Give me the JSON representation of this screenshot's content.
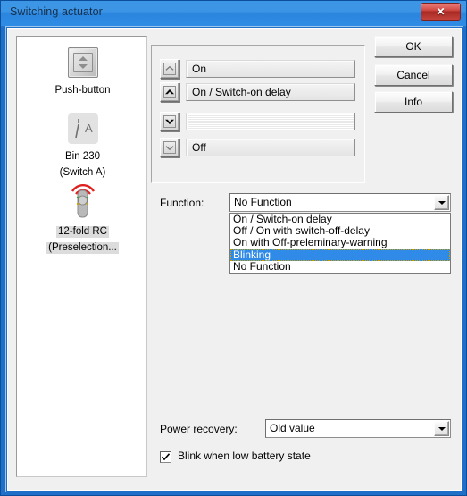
{
  "window": {
    "title": "Switching actuator",
    "close_label": "✕",
    "close_icon": "close-icon"
  },
  "devices": [
    {
      "id": "push-button",
      "icon": "push-button-icon",
      "lines": [
        "Push-button"
      ],
      "selected": false
    },
    {
      "id": "bin-230",
      "icon": "switch-contact-icon",
      "lines": [
        "Bin 230",
        "(Switch A)"
      ],
      "selected": false
    },
    {
      "id": "12-fold-rc",
      "icon": "remote-control-icon",
      "lines": [
        "12-fold RC",
        "(Preselection..."
      ],
      "selected": true
    }
  ],
  "buttons": [
    {
      "id": "ok",
      "label": "OK"
    },
    {
      "id": "cancel",
      "label": "Cancel"
    },
    {
      "id": "info",
      "label": "Info"
    }
  ],
  "scene_rows": [
    {
      "arrow": "chevron-up-light",
      "text": "On",
      "empty": false
    },
    {
      "arrow": "chevron-up-bold",
      "text": "On / Switch-on delay",
      "empty": false
    },
    {
      "arrow": "chevron-down-bold",
      "text": "",
      "empty": true
    },
    {
      "arrow": "chevron-down-light",
      "text": "Off",
      "empty": false
    }
  ],
  "function_field": {
    "label": "Function:",
    "value": "No Function",
    "options": [
      "On / Switch-on delay",
      "Off / On with switch-off-delay",
      "On with Off-preleminary-warning",
      "Blinking",
      "No Function"
    ],
    "selected_index": 3
  },
  "power_recovery": {
    "label": "Power recovery:",
    "value": "Old value"
  },
  "blink_checkbox": {
    "label": "Blink when low battery state",
    "checked": true,
    "check_glyph": "✔"
  },
  "colors": {
    "title_bar": "#3d95e6",
    "window_border": "#1f6fc9",
    "highlight": "#2f8ae8",
    "close_button": "#c4433c",
    "client_bg": "#f0f0f0",
    "panel_bg": "#ffffff"
  }
}
